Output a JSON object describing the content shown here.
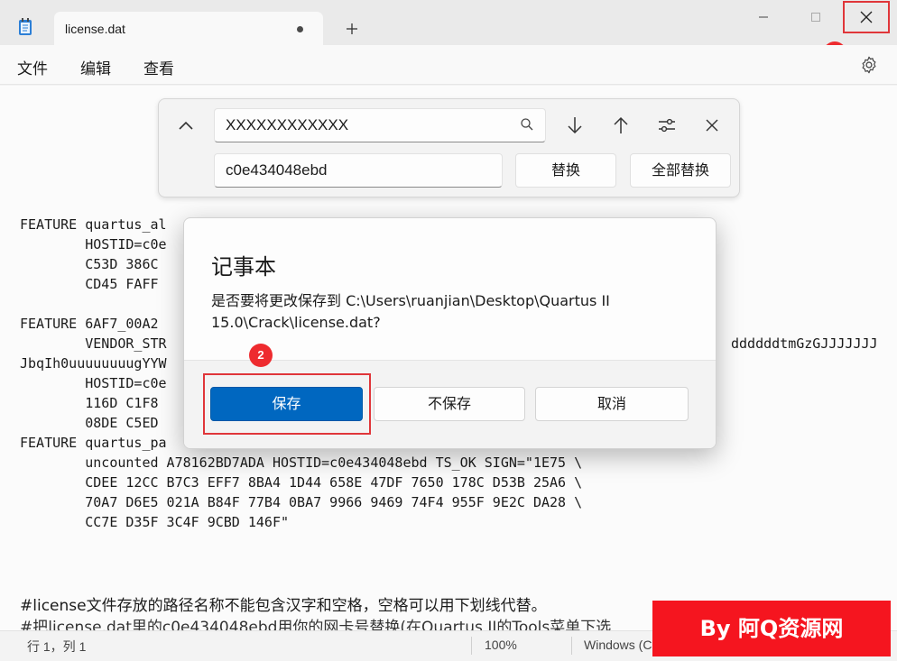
{
  "tab": {
    "title": "license.dat"
  },
  "menu": {
    "file": "文件",
    "edit": "编辑",
    "view": "查看"
  },
  "find": {
    "search_value": "XXXXXXXXXXXX",
    "replace_value": "c0e434048ebd",
    "replace_label": "替换",
    "replace_all_label": "全部替换"
  },
  "editor": {
    "lines": [
      "FEATURE quartus_al",
      "        HOSTID=c0e",
      "        C53D 386C",
      "        CD45 FAFF",
      "",
      "FEATURE 6AF7_00A2",
      "        VENDOR_STR",
      "JbqIh0uuuuuuuugYYW",
      "        HOSTID=c0e",
      "        116D C1F8",
      "        08DE C5ED",
      "FEATURE quartus_pa",
      "        uncounted A78162BD7ADA HOSTID=c0e434048ebd TS_OK SIGN=\"1E75 \\",
      "        CDEE 12CC B7C3 EFF7 8BA4 1D44 658E 47DF 7650 178C D53B 25A6 \\",
      "        70A7 D6E5 021A B84F 77B4 0BA7 9966 9469 74F4 955F 9E2C DA28 \\",
      "        CC7E D35F 3C4F 9CBD 146F\""
    ],
    "right_fragment": "ddddddtmGzGJJJJJJJ",
    "comment_1": "#license文件存放的路径名称不能包含汉字和空格，空格可以用下划线代替。",
    "comment_2": "#把license.dat里的c0e434048ebd用你的网卡号替换(在Quartus II的Tools菜单下选"
  },
  "dialog": {
    "title": "记事本",
    "message": "是否要将更改保存到 C:\\Users\\ruanjian\\Desktop\\Quartus II 15.0\\Crack\\license.dat?",
    "save_label": "保存",
    "dont_save_label": "不保存",
    "cancel_label": "取消"
  },
  "status": {
    "position": "行 1，列 1",
    "zoom": "100%",
    "line_ending": "Windows (C"
  },
  "badges": {
    "one": "1",
    "two": "2"
  },
  "watermark": "By 阿Q资源网",
  "colors": {
    "accent": "#0067c0",
    "highlight": "#e0363a",
    "watermark": "#f5151f"
  }
}
